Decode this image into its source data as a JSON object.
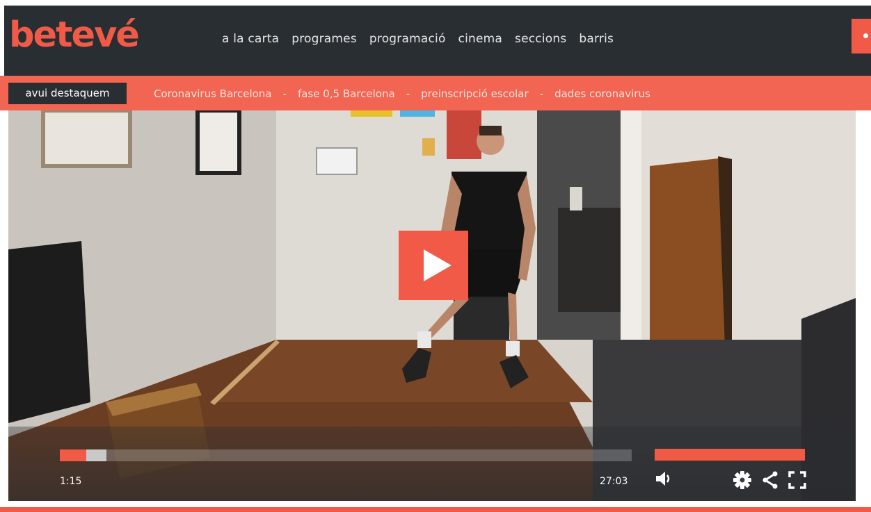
{
  "header": {
    "logo": "betevé",
    "nav": [
      "a la carta",
      "programes",
      "programació",
      "cinema",
      "seccions",
      "barris"
    ],
    "search_icon": "search-icon"
  },
  "highlights": {
    "badge": "avui destaquem",
    "separator": "-",
    "items": [
      "Coronavirus Barcelona",
      "fase 0,5 Barcelona",
      "preinscripció escolar",
      "dades coronavirus"
    ]
  },
  "player": {
    "current_time": "1:15",
    "duration": "27:03",
    "progress_fraction": 0.046,
    "buffered_fraction": 0.081,
    "volume_fraction": 1.0,
    "icons": [
      "play-icon",
      "volume-icon",
      "gear-icon",
      "share-icon",
      "fullscreen-icon"
    ]
  },
  "colors": {
    "accent": "#f05a47",
    "header_bg": "#292e33",
    "highlight_bar": "#f26552"
  }
}
